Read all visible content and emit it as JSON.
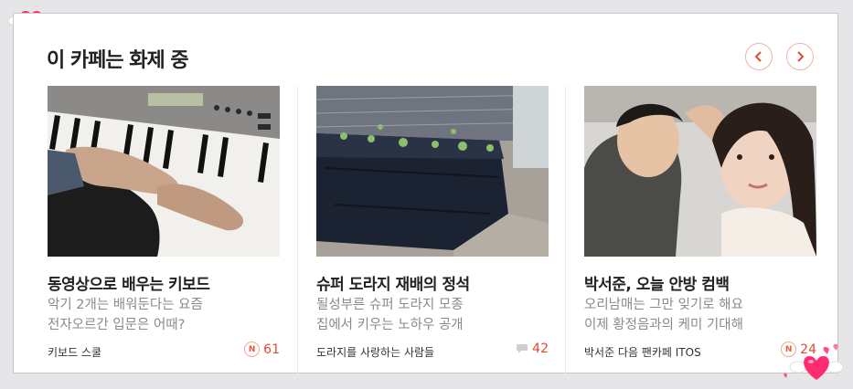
{
  "section": {
    "title": "이 카페는 화제 중"
  },
  "cards": [
    {
      "title": "동영상으로 배우는 키보드",
      "desc": [
        "악기 2개는 배워둔다는 요즘",
        "전자오르간 입문은 어때?"
      ],
      "source": "키보드 스쿨",
      "count": "61",
      "count_icon": "n-badge-icon"
    },
    {
      "title": "슈퍼 도라지 재배의 정석",
      "desc": [
        "될성부른 슈퍼 도라지 모종",
        "집에서 키우는 노하우 공개"
      ],
      "source": "도라지를 사랑하는 사람들",
      "count": "42",
      "count_icon": "comment-icon"
    },
    {
      "title": "박서준, 오늘 안방 컴백",
      "desc": [
        "오리남매는 그만 잊기로 해요",
        "이제 황정음과의 케미 기대해"
      ],
      "source": "박서준 다음 팬카페 ITOS",
      "count": "24",
      "count_icon": "n-badge-icon"
    }
  ],
  "badge_letter": "N",
  "colors": {
    "accent": "#e24a2f",
    "nav_border": "#f1b3a8",
    "heart": "#ff2d6f"
  }
}
